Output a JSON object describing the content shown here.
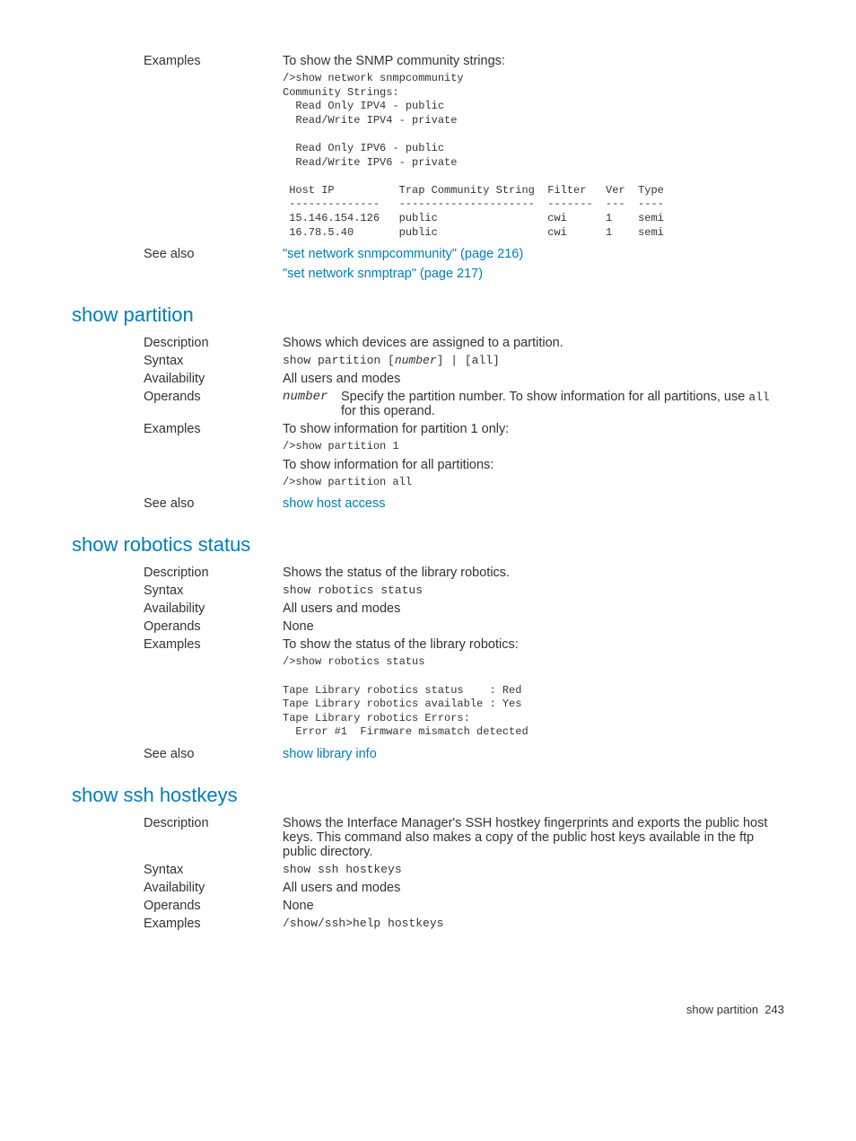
{
  "snmp_prev": {
    "examples_label": "Examples",
    "examples_intro": "To show the SNMP community strings:",
    "examples_output": "/>show network snmpcommunity\nCommunity Strings:\n  Read Only IPV4 - public\n  Read/Write IPV4 - private\n\n  Read Only IPV6 - public\n  Read/Write IPV6 - private\n\n Host IP          Trap Community String  Filter   Ver  Type\n --------------   ---------------------  -------  ---  ----\n 15.146.154.126   public                 cwi      1    semi\n 16.78.5.40       public                 cwi      1    semi",
    "seealso_label": "See also",
    "seealso_1": "\"set network snmpcommunity\" (page 216)",
    "seealso_2": "\"set network snmptrap\" (page 217)"
  },
  "partition": {
    "title": "show partition",
    "desc_label": "Description",
    "desc_text": "Shows which devices are assigned to a partition.",
    "syntax_label": "Syntax",
    "syntax_pre": "show partition [",
    "syntax_operand": "number",
    "syntax_post": "]  |  [all]",
    "avail_label": "Availability",
    "avail_text": "All users and modes",
    "operands_label": "Operands",
    "operand_name": "number",
    "operand_desc_pre": "Specify the partition number. To show information for all partitions, use ",
    "operand_desc_code": "all",
    "operand_desc_post": " for this operand.",
    "examples_label": "Examples",
    "examples_intro1": "To show information for partition 1 only:",
    "examples_cmd1": "/>show partition 1",
    "examples_intro2": "To show information for all partitions:",
    "examples_cmd2": "/>show partition all",
    "seealso_label": "See also",
    "seealso_link": "show host access"
  },
  "robotics": {
    "title": "show robotics status",
    "desc_label": "Description",
    "desc_text": "Shows the status of the library robotics.",
    "syntax_label": "Syntax",
    "syntax_text": "show robotics status",
    "avail_label": "Availability",
    "avail_text": "All users and modes",
    "operands_label": "Operands",
    "operands_text": "None",
    "examples_label": "Examples",
    "examples_intro": "To show the status of the library robotics:",
    "examples_output": "/>show robotics status\n\nTape Library robotics status    : Red\nTape Library robotics available : Yes\nTape Library robotics Errors:\n  Error #1  Firmware mismatch detected",
    "seealso_label": "See also",
    "seealso_link": "show library info"
  },
  "ssh": {
    "title": "show ssh hostkeys",
    "desc_label": "Description",
    "desc_text": "Shows the Interface Manager's SSH hostkey fingerprints and exports the public host keys. This command also makes a copy of the public host keys available in the ftp public directory.",
    "syntax_label": "Syntax",
    "syntax_text": "show ssh hostkeys",
    "avail_label": "Availability",
    "avail_text": "All users and modes",
    "operands_label": "Operands",
    "operands_text": "None",
    "examples_label": "Examples",
    "examples_text": "/show/ssh>help hostkeys"
  },
  "footer": {
    "text": "show partition",
    "page": "243"
  }
}
